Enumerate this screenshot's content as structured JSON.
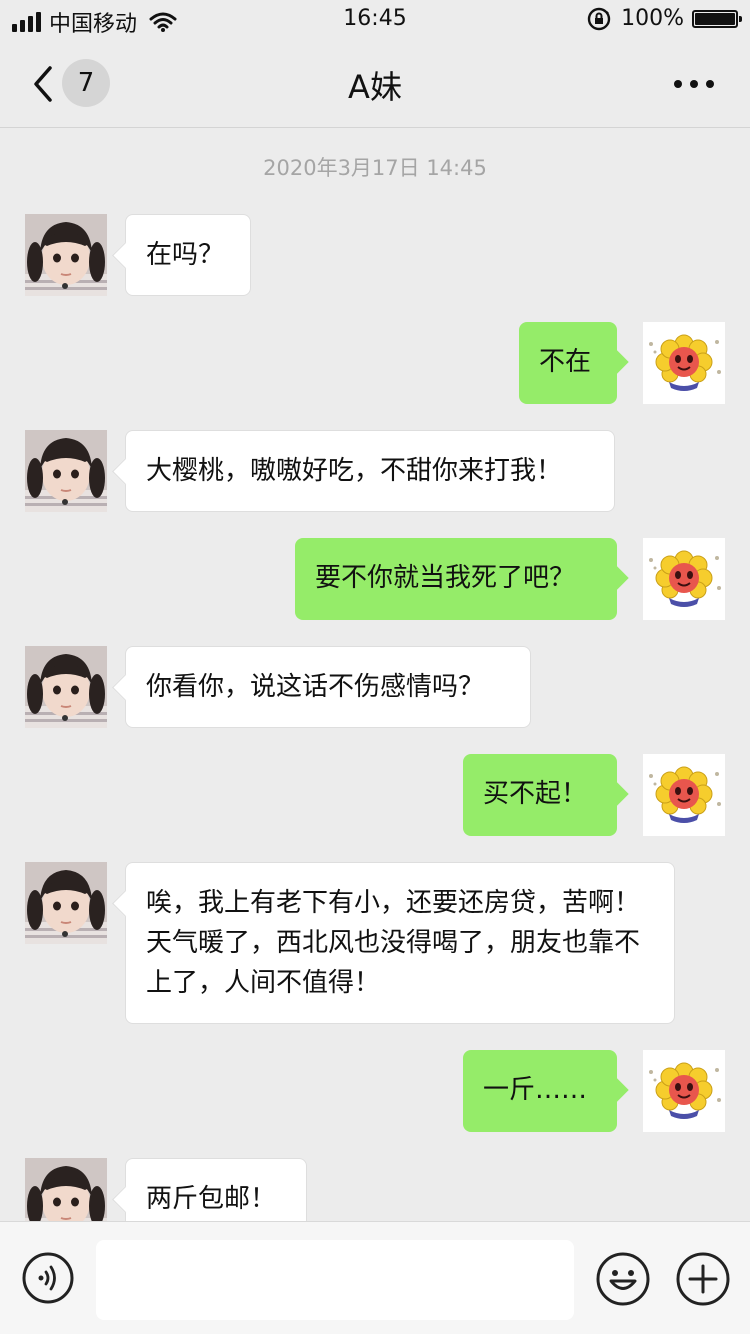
{
  "status_bar": {
    "carrier": "中国移动",
    "time": "16:45",
    "battery": "100%"
  },
  "nav": {
    "unread_count": "7",
    "title": "A妹"
  },
  "chat": {
    "timestamp": "2020年3月17日 14:45",
    "messages": [
      {
        "side": "left",
        "text": "在吗？"
      },
      {
        "side": "right",
        "text": "不在"
      },
      {
        "side": "left",
        "text": "大樱桃，嗷嗷好吃，不甜你来打我！"
      },
      {
        "side": "right",
        "text": "要不你就当我死了吧？"
      },
      {
        "side": "left",
        "text": "你看你，说这话不伤感情吗？"
      },
      {
        "side": "right",
        "text": "买不起！"
      },
      {
        "side": "left",
        "text": "唉，我上有老下有小，还要还房贷，苦啊！天气暖了，西北风也没得喝了，朋友也靠不上了，人间不值得！"
      },
      {
        "side": "right",
        "text": "一斤……"
      },
      {
        "side": "left",
        "text": "两斤包邮！"
      }
    ]
  },
  "colors": {
    "sent_bubble": "#95ec69",
    "received_bubble": "#ffffff",
    "background": "#ececec"
  }
}
